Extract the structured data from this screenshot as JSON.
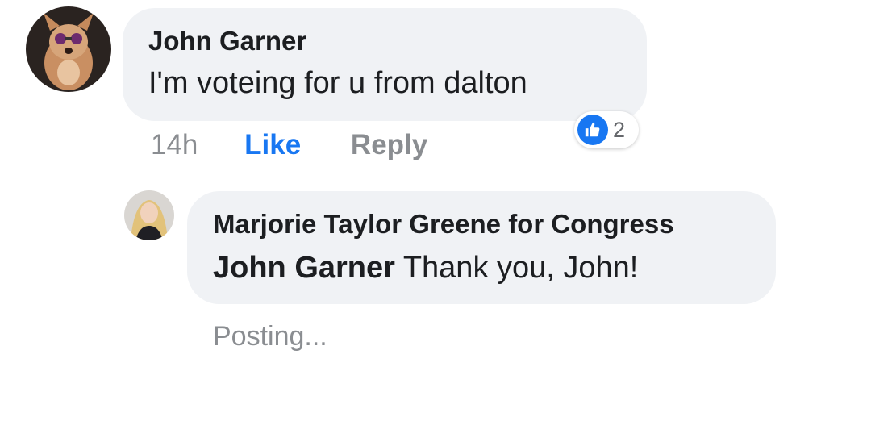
{
  "comment": {
    "author": "John Garner",
    "text": "I'm voteing for u from dalton",
    "time": "14h",
    "like_label": "Like",
    "reply_label": "Reply",
    "reaction": {
      "icon": "thumbs-up-icon",
      "count": "2",
      "color": "#1877f2"
    },
    "avatar": "dog-with-sunglasses-avatar"
  },
  "reply": {
    "author": "Marjorie Taylor Greene for Congress",
    "mention": "John Garner",
    "text": "Thank you, John!",
    "status": "Posting...",
    "avatar": "woman-portrait-avatar"
  },
  "colors": {
    "bubble": "#f0f2f5",
    "like_active": "#1877f2",
    "muted": "#8a8d91"
  }
}
